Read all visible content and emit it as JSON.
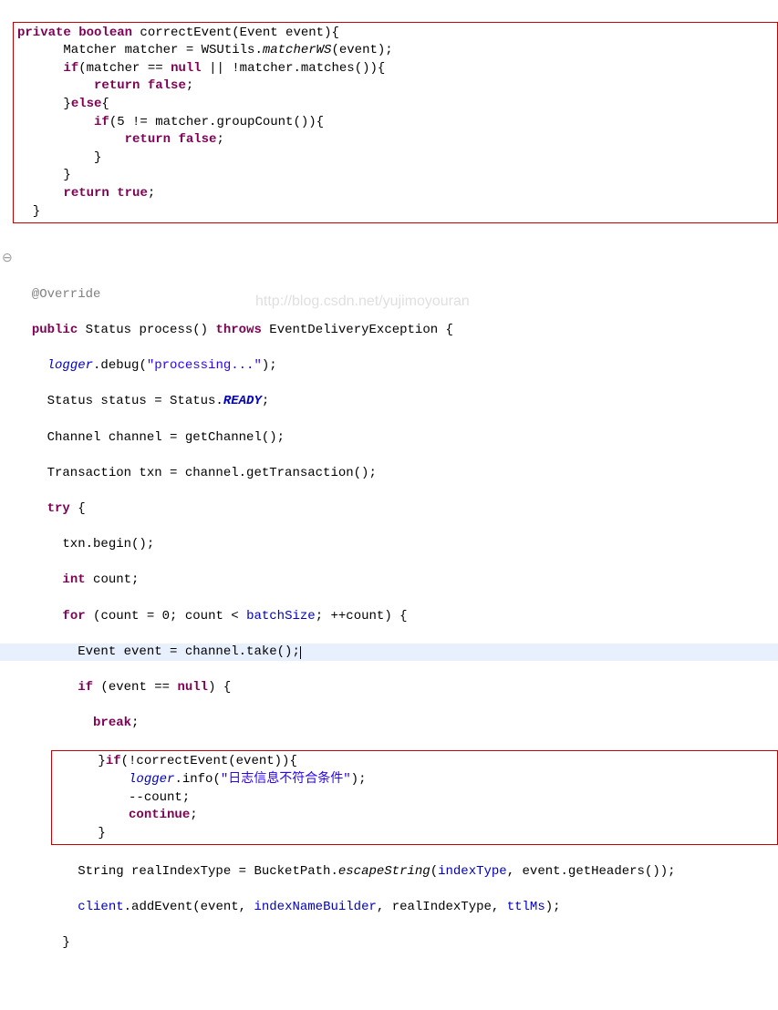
{
  "watermark": "http://blog.csdn.net/yujimoyouran",
  "method1": {
    "sig_priv": "private",
    "sig_bool": "boolean",
    "sig_name": " correctEvent(Event event){",
    "l2a": "      Matcher matcher = WSUtils.",
    "l2b": "matcherWS",
    "l2c": "(event);",
    "l3a": "      ",
    "l3if": "if",
    "l3b": "(matcher == ",
    "l3null": "null",
    "l3c": " || !matcher.matches()){",
    "l4a": "          ",
    "l4ret": "return",
    "l4b": " ",
    "l4false": "false",
    "l4c": ";",
    "l5a": "      }",
    "l5else": "else",
    "l5b": "{",
    "l6a": "          ",
    "l6if": "if",
    "l6b": "(5 != matcher.groupCount()){",
    "l7a": "              ",
    "l7ret": "return",
    "l7b": " ",
    "l7false": "false",
    "l7c": ";",
    "l8": "          }",
    "l9": "      }",
    "l10a": "      ",
    "l10ret": "return",
    "l10b": " ",
    "l10true": "true",
    "l10c": ";",
    "l11": "  }"
  },
  "gap_collapse": "⊖",
  "method2": {
    "ann": "  @Override",
    "sig_a": "  ",
    "sig_pub": "public",
    "sig_b": " Status process() ",
    "sig_throws": "throws",
    "sig_c": " EventDeliveryException {",
    "l2a": "    ",
    "l2logger": "logger",
    "l2b": ".debug(",
    "l2str": "\"processing...\"",
    "l2c": ");",
    "l3a": "    Status status = Status.",
    "l3ready": "READY",
    "l3b": ";",
    "l4": "    Channel channel = getChannel();",
    "l5": "    Transaction txn = channel.getTransaction();",
    "l6a": "    ",
    "l6try": "try",
    "l6b": " {",
    "l7": "      txn.begin();",
    "l8a": "      ",
    "l8int": "int",
    "l8b": " count;",
    "l9a": "      ",
    "l9for": "for",
    "l9b": " (count = 0; count < ",
    "l9batch": "batchSize",
    "l9c": "; ++count) {",
    "l10": "        Event event = channel.take();",
    "l11a": "        ",
    "l11if": "if",
    "l11b": " (event == ",
    "l11null": "null",
    "l11c": ") {",
    "l12a": "          ",
    "l12break": "break",
    "l12b": ";",
    "box_l1a": "      }",
    "box_l1if": "if",
    "box_l1b": "(!correctEvent(event)){",
    "box_l2a": "          ",
    "box_l2logger": "logger",
    "box_l2b": ".info(",
    "box_l2str": "\"日志信息不符合条件\"",
    "box_l2c": ");",
    "box_l3": "          --count;",
    "box_l4a": "          ",
    "box_l4cont": "continue",
    "box_l4b": ";",
    "box_l5": "      }",
    "l18a": "        String realIndexType = BucketPath.",
    "l18esc": "escapeString",
    "l18b": "(",
    "l18idx": "indexType",
    "l18c": ", event.getHeaders());",
    "l19a": "        ",
    "l19client": "client",
    "l19b": ".addEvent(event, ",
    "l19inb": "indexNameBuilder",
    "l19c": ", realIndexType, ",
    "l19ttl": "ttlMs",
    "l19d": ");",
    "l20": "      }"
  }
}
